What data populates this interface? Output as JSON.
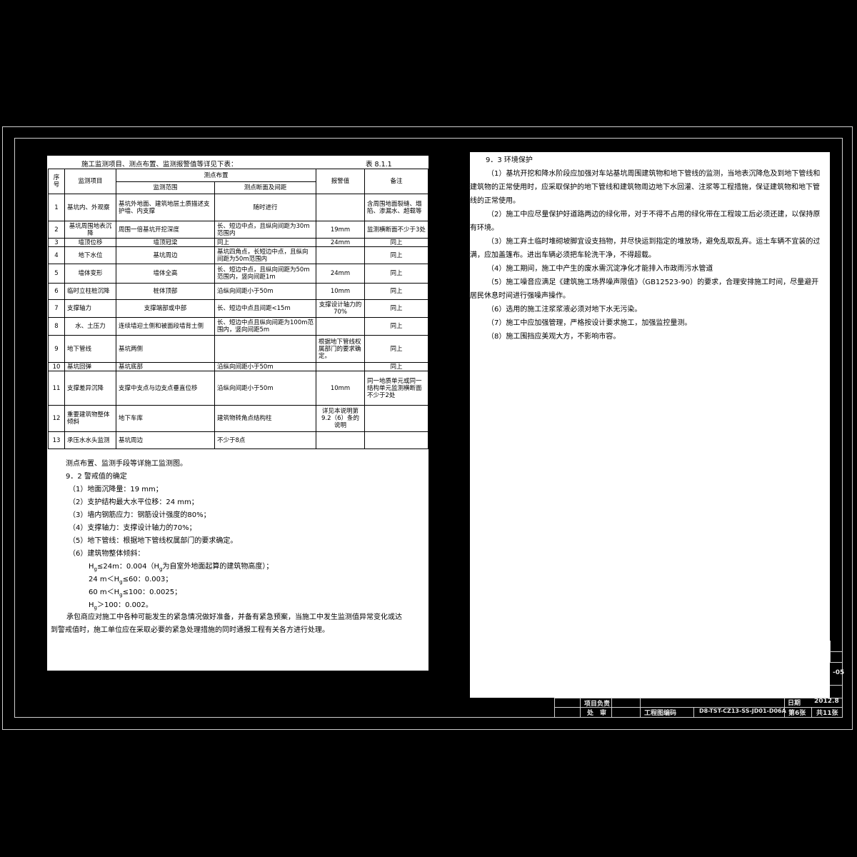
{
  "table": {
    "caption": "施工监测项目、测点布置、监测报警值等详见下表：",
    "number": "表 8.1.1",
    "headers": {
      "seq": "序号",
      "item": "监测项目",
      "layout": "测点布置",
      "range": "监测范围",
      "section": "测点断面及间距",
      "alarm": "报警值",
      "note": "备注"
    },
    "rows": [
      {
        "no": "1",
        "item": "基坑内、外观察",
        "range": "基坑外地面、建筑地层土质描述支护墙、内支撑",
        "section": "随时进行",
        "alarm": "",
        "note": "含周围地面裂缝、塌陷、渗漏水、超载等"
      },
      {
        "no": "2",
        "item": "基坑周围地表沉降",
        "range": "周围一倍基坑开挖深度",
        "section": "长、短边中点，且纵向间距为30m范围内",
        "alarm": "19mm",
        "note": "监测横断面不少于3处"
      },
      {
        "no": "3",
        "item": "墙顶位移",
        "range": "墙顶冠梁",
        "section": "同上",
        "alarm": "24mm",
        "note": "同上"
      },
      {
        "no": "4",
        "item": "地下水位",
        "range": "基坑周边",
        "section": "基坑四角点，长短边中点，且纵向间距为50m范围内",
        "alarm": "",
        "note": "同上"
      },
      {
        "no": "5",
        "item": "墙体变形",
        "range": "墙体全高",
        "section": "长、短边中点，且纵向间距为50m范围内，竖向间距1m",
        "alarm": "24mm",
        "note": "同上"
      },
      {
        "no": "6",
        "item": "临时立柱桩沉降",
        "range": "桩体顶部",
        "section": "沿纵向间距小于50m",
        "alarm": "10mm",
        "note": "同上"
      },
      {
        "no": "7",
        "item": "支撑轴力",
        "range": "支撑端部或中部",
        "section": "长、短边中点且间距<15m",
        "alarm": "支撑设计轴力的70%",
        "note": "同上"
      },
      {
        "no": "8",
        "item": "水、土压力",
        "range": "连续墙迎土侧和被面段墙背土侧",
        "section": "长、短边中点且纵向间距为100m范围内，竖向间距5m",
        "alarm": "",
        "note": "同上"
      },
      {
        "no": "9",
        "item": "地下管线",
        "range": "基坑两侧",
        "section": "",
        "alarm": "根据地下管线权属部门的要求确定。",
        "note": "同上"
      },
      {
        "no": "10",
        "item": "基坑回弹",
        "range": "基坑底部",
        "section": "沿纵向间距小于50m",
        "alarm": "",
        "note": "同上"
      },
      {
        "no": "11",
        "item": "支撑差异沉降",
        "range": "支撑中支点与边支点垂直位移",
        "section": "沿纵向间距小于50m",
        "alarm": "10mm",
        "note": "同一地质单元或同一结构单元监测横断面不少于2处"
      },
      {
        "no": "12",
        "item": "重要建筑物整体倾斜",
        "range": "地下车库",
        "section": "建筑物转角点结构柱",
        "alarm": "详见本说明第9.2（6）条的说明",
        "note": ""
      },
      {
        "no": "13",
        "item": "承压水水头监测",
        "range": "基坑周边",
        "section": "不少于8点",
        "alarm": "",
        "note": ""
      }
    ]
  },
  "left_text": {
    "after_table": "测点布置、监测手段等详施工监测图。",
    "sec_title": "9．2 警戒值的确定",
    "items": [
      "（1）地面沉降量：19 mm；",
      "（2）支护结构最大水平位移：24 mm；",
      "（3）墙内钢筋应力：钢筋设计强度的80%；",
      "（4）支撑轴力：支撑设计轴力的70%；",
      "（5）地下管线：根据地下管线权属部门的要求确定。",
      "（6）建筑物整体倾斜："
    ],
    "h_lines": [
      {
        "pre": "H",
        "sub": "g",
        "post": "≤24m：0.004（H",
        "sub2": "g",
        "post2": "为自室外地面起算的建筑物高度）；"
      },
      {
        "pre": "24 m＜H",
        "sub": "g",
        "post": "≤60：0.003；",
        "sub2": "",
        "post2": ""
      },
      {
        "pre": "60 m＜H",
        "sub": "g",
        "post": "≤100：0.0025；",
        "sub2": "",
        "post2": ""
      },
      {
        "pre": "H",
        "sub": "g",
        "post": "＞100：0.002。",
        "sub2": "",
        "post2": ""
      }
    ],
    "closing": "承包商应对施工中各种可能发生的紧急情况做好准备，并备有紧急预案，当施工中发生监测值异常变化或达到警戒值时，施工单位应在采取必要的紧急处理措施的同时通报工程有关各方进行处理。"
  },
  "right_text": {
    "sec_title": "9．3 环境保护",
    "paras": [
      "（1）基坑开挖和降水阶段应加强对车站基坑周围建筑物和地下管线的监测，当地表沉降危及到地下管线和建筑物的正常使用时，应采取保护的地下管线和建筑物周边地下水回灌、注浆等工程措施，保证建筑物和地下管线的正常使用。",
      "（2）施工中应尽量保护好道路两边的绿化带，对于不得不占用的绿化带在工程竣工后必须还建，以保持原有环境。",
      "（3）施工弃土临时堆砌坡脚宜设支挡物，并尽快运到指定的堆放场，避免乱取乱弃。运土车辆不宜装的过满，应加盖篷布。进出车辆必须把车轮洗干净，不得超载。",
      "（4）施工期间，施工中产生的废水需沉淀净化才能排入市政雨污水管道",
      "（5）施工噪音应满足《建筑施工场界噪声限值》（GB12523-90）的要求，合理安排施工时间，尽量避开居民休息时间进行强噪声操作。",
      "（6）选用的施工注浆浆液必须对地下水无污染。",
      "（7）施工中应加强管理，严格按设计要求施工，加强监控量测。",
      "（8）施工围挡应美观大方，不影响市容。"
    ]
  },
  "title_block": {
    "project_leader": "项目负责",
    "review": "处　审",
    "drawing_code_label": "工程图编码",
    "drawing_code": "D8-TST-CZ13-SS-JD01-D06A",
    "sheet": "第6张",
    "total": "共11张",
    "date_label": "日期",
    "date_value": "2012.8",
    "code_fragment": "-05"
  }
}
